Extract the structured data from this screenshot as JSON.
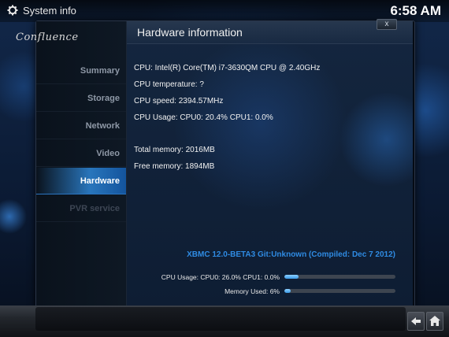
{
  "topbar": {
    "title": "System info",
    "clock": "6:58 AM",
    "icon": "gear-icon"
  },
  "sidebar": {
    "logo": "Confluence",
    "items": [
      {
        "label": "Summary",
        "state": "normal"
      },
      {
        "label": "Storage",
        "state": "normal"
      },
      {
        "label": "Network",
        "state": "normal"
      },
      {
        "label": "Video",
        "state": "normal"
      },
      {
        "label": "Hardware",
        "state": "active"
      },
      {
        "label": "PVR service",
        "state": "disabled"
      }
    ]
  },
  "main": {
    "heading": "Hardware information",
    "close_label": "x",
    "info_lines": [
      "CPU: Intel(R) Core(TM) i7-3630QM CPU @ 2.40GHz",
      "CPU temperature: ?",
      "CPU speed: 2394.57MHz",
      "CPU Usage: CPU0: 20.4% CPU1: 0.0%",
      "Total memory: 2016MB",
      "Free memory: 1894MB"
    ],
    "version": "XBMC 12.0-BETA3 Git:Unknown (Compiled: Dec  7 2012)",
    "meters": [
      {
        "label": "CPU Usage: CPU0: 26.0% CPU1: 0.0%",
        "percent": 13
      },
      {
        "label": "Memory Used: 6%",
        "percent": 6
      }
    ]
  },
  "bottom": {
    "back_icon": "back-arrow-icon",
    "home_icon": "home-icon"
  },
  "colors": {
    "accent": "#2f8be3",
    "active_nav": "#3296f0",
    "panel_bg": "#14263f"
  }
}
